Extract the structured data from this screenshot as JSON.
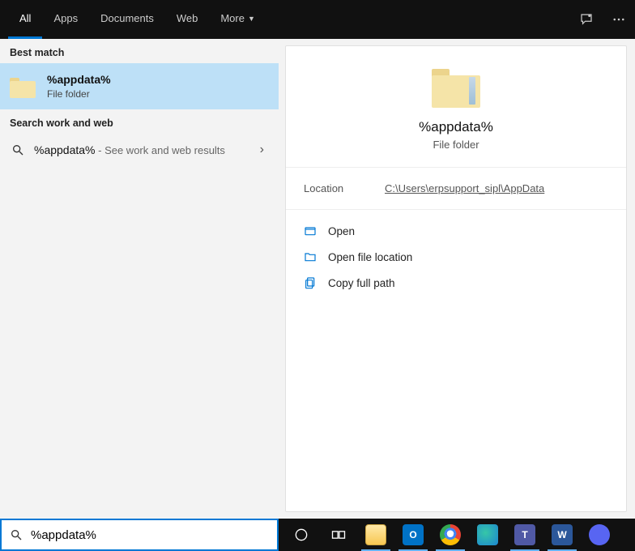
{
  "tabs": {
    "all": "All",
    "apps": "Apps",
    "documents": "Documents",
    "web": "Web",
    "more": "More"
  },
  "left": {
    "best_header": "Best match",
    "best": {
      "title": "%appdata%",
      "sub": "File folder"
    },
    "work_header": "Search work and web",
    "web": {
      "term": "%appdata%",
      "hint": " - See work and web results"
    }
  },
  "preview": {
    "title": "%appdata%",
    "sub": "File folder",
    "location_label": "Location",
    "location_value": "C:\\Users\\erpsupport_sipl\\AppData",
    "actions": {
      "open": "Open",
      "openloc": "Open file location",
      "copypath": "Copy full path"
    }
  },
  "search": {
    "value": "%appdata%"
  }
}
